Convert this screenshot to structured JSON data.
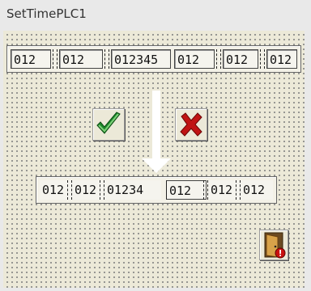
{
  "window": {
    "title": "SetTimePLC1"
  },
  "top_fields": [
    "012",
    "012",
    "012345",
    "012",
    "012",
    "012"
  ],
  "bottom_fields": [
    "012",
    "012",
    "01234",
    "012",
    "012",
    "012"
  ],
  "buttons": {
    "confirm_icon": "checkmark-icon",
    "cancel_icon": "x-icon",
    "exit_icon": "door-exit-icon"
  }
}
